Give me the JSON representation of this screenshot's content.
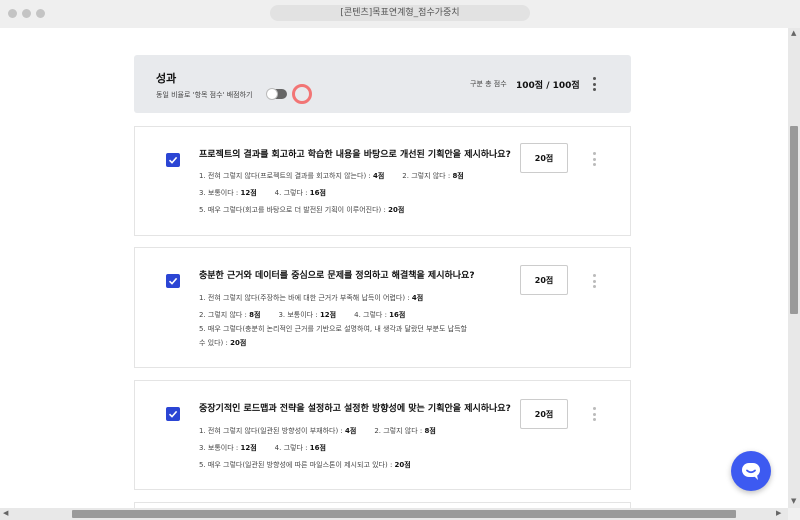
{
  "window": {
    "title": "[콘텐츠]목표연계형_점수가중치"
  },
  "section": {
    "title": "성과",
    "subtitle": "동일 비율로 '항목 점수' 배점하기",
    "total_label": "구분 총 점수",
    "total_value": "100점 / 100점",
    "toggle_on": false
  },
  "cards": [
    {
      "question": "프로젝트의 결과를 회고하고 학습한 내용을 바탕으로 개선된 기획안을 제시하나요?",
      "score": "20점",
      "lines": [
        [
          {
            "text": "1. 전혀 그렇지 않다(프로젝트의 결과를 회고하지 않는다) : ",
            "score": "4점"
          },
          {
            "text": "2. 그렇지 않다 : ",
            "score": "8점"
          }
        ],
        [
          {
            "text": "3. 보통이다 : ",
            "score": "12점"
          },
          {
            "text": "4. 그렇다 : ",
            "score": "16점"
          }
        ],
        [
          {
            "text": "5. 매우 그렇다(회고를 바탕으로 더 발전된 기획이 이루어진다) : ",
            "score": "20점"
          }
        ]
      ]
    },
    {
      "question": "충분한 근거와 데이터를 중심으로 문제를 정의하고 해결책을 제시하나요?",
      "score": "20점",
      "lines": [
        [
          {
            "text": "1. 전혀 그렇지 않다(주장하는 바에 대한 근거가 부족해 납득이 어렵다) : ",
            "score": "4점"
          }
        ],
        [
          {
            "text": "2. 그렇지 않다 : ",
            "score": "8점"
          },
          {
            "text": "3. 보통이다 : ",
            "score": "12점"
          },
          {
            "text": "4. 그렇다 : ",
            "score": "16점"
          }
        ],
        [
          {
            "text": "5. 매우 그렇다(충분히 논리적인 근거를 기반으로 설명하여, 내 생각과 달랐던 부분도 납득할",
            "score": ""
          }
        ],
        [
          {
            "text": "수 있다) : ",
            "score": "20점"
          }
        ]
      ]
    },
    {
      "question": "중장기적인 로드맵과 전략을 설정하고 설정한 방향성에 맞는 기획안을 제시하나요?",
      "score": "20점",
      "lines": [
        [
          {
            "text": "1. 전혀 그렇지 않다(일관된 방향성이 부재하다) : ",
            "score": "4점"
          },
          {
            "text": "2. 그렇지 않다 : ",
            "score": "8점"
          }
        ],
        [
          {
            "text": "3. 보통이다 : ",
            "score": "12점"
          },
          {
            "text": "4. 그렇다 : ",
            "score": "16점"
          }
        ],
        [
          {
            "text": "5. 매우 그렇다(일관된 방향성에 따른 마일스톤이 제시되고 있다) : ",
            "score": "20점"
          }
        ]
      ]
    }
  ],
  "icons": {
    "check": "check-icon",
    "more": "more-vertical-icon",
    "chat": "chat-bubble-icon"
  },
  "colors": {
    "accent": "#2b45d4",
    "ring": "#f27575",
    "chat": "#3d5af1"
  }
}
